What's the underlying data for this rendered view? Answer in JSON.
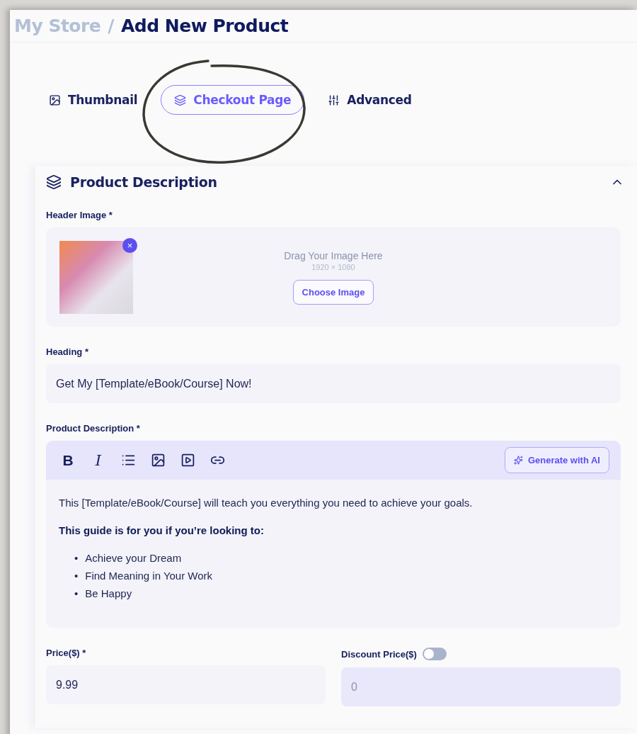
{
  "breadcrumb": {
    "parent": "My Store",
    "separator": "/",
    "current": "Add New Product"
  },
  "tabs": [
    {
      "label": "Thumbnail",
      "selected": false
    },
    {
      "label": "Checkout Page",
      "selected": true
    },
    {
      "label": "Advanced",
      "selected": false
    }
  ],
  "section": {
    "title": "Product Description",
    "expanded": true
  },
  "header_image": {
    "label": "Header Image *",
    "drop_text": "Drag Your Image Here",
    "size_hint": "1920 × 1080",
    "remove": "×",
    "button": "Choose Image"
  },
  "heading": {
    "label": "Heading *",
    "value": "Get My [Template/eBook/Course] Now!"
  },
  "description": {
    "label": "Product Description *",
    "toolbar": [
      {
        "kind": "bold",
        "label": "B"
      },
      {
        "kind": "italic",
        "label": "I"
      },
      {
        "kind": "list"
      },
      {
        "kind": "image"
      },
      {
        "kind": "video"
      },
      {
        "kind": "link"
      }
    ],
    "ai_button": "Generate with AI",
    "intro": "This [Template/eBook/Course] will teach you everything you need to achieve your goals.",
    "subheading": "This guide is for you if you’re looking to:",
    "bullets": [
      {
        "marker": "•",
        "text": "Achieve your Dream"
      },
      {
        "marker": "•",
        "text": "Find Meaning in Your Work"
      },
      {
        "marker": "•",
        "text": "Be Happy"
      }
    ]
  },
  "price": {
    "label": "Price($) *",
    "value": "9.99"
  },
  "discount": {
    "label": "Discount Price($)",
    "on": false,
    "value": "0"
  }
}
